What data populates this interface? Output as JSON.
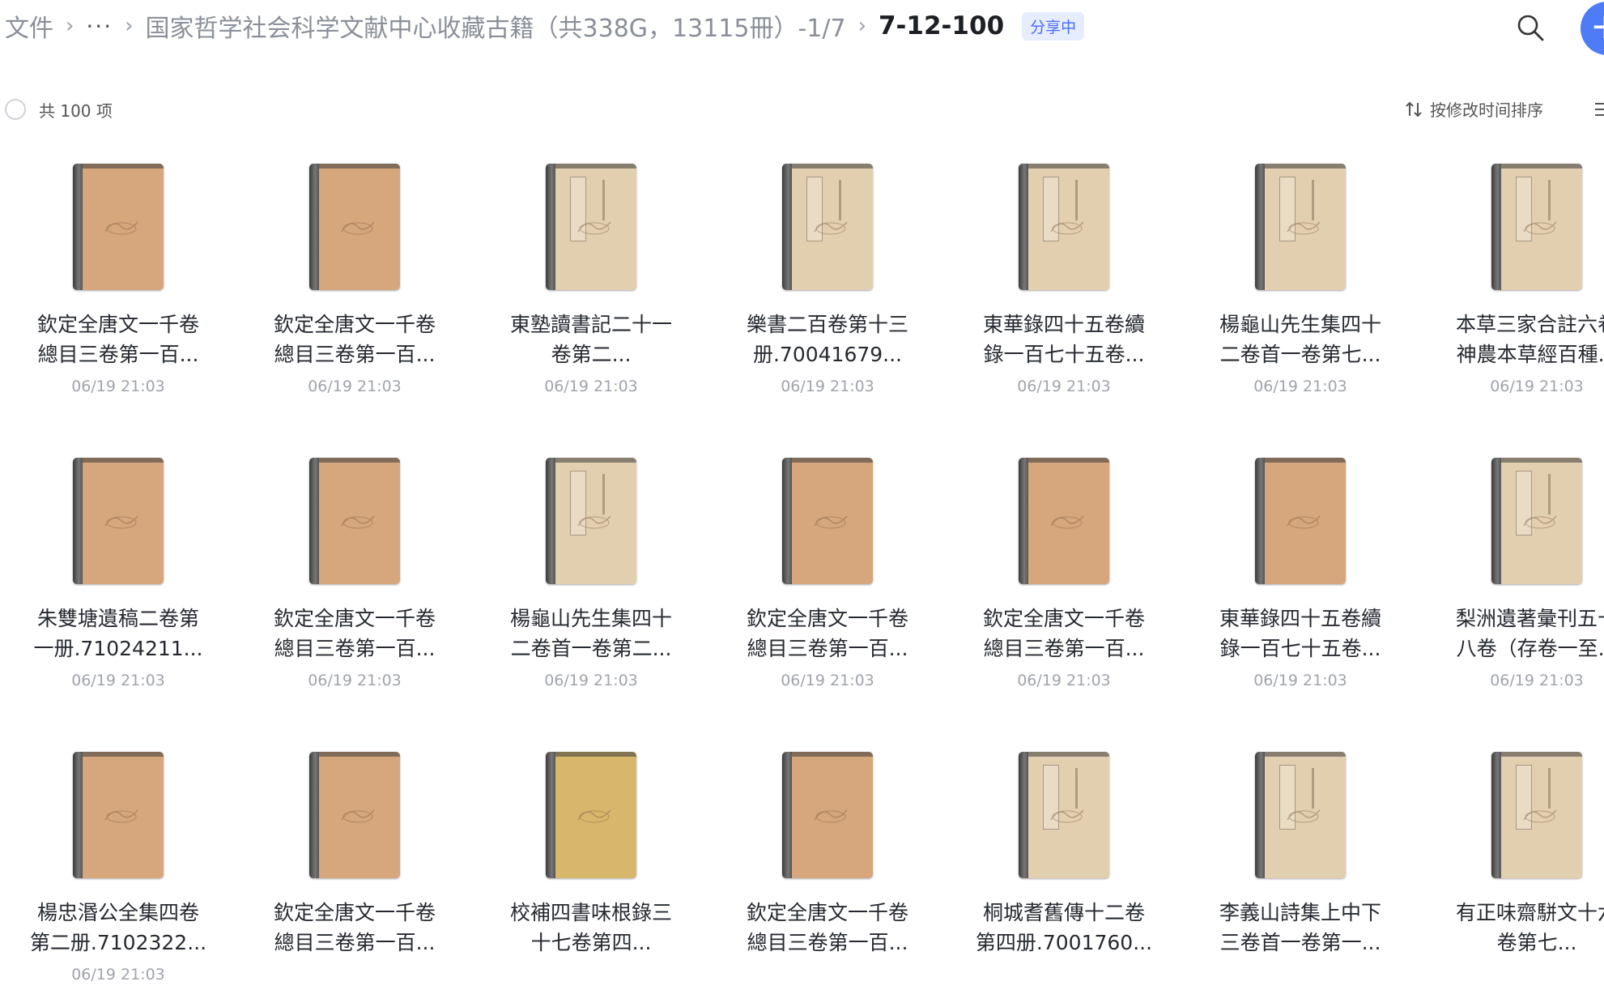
{
  "breadcrumb": {
    "root": "文件",
    "ellipsis": "···",
    "parent": "国家哲学社会科学文献中心收藏古籍（共338G，13115冊）-1/7",
    "current": "7-12-100",
    "badge": "分享中"
  },
  "toolbar": {
    "total": "共 100 项",
    "sort_label": "按修改时间排序"
  },
  "icons": {
    "search": "search-icon",
    "add": "plus-icon",
    "sort": "sort-arrows-icon",
    "view": "list-view-icon",
    "checkbox": "circle-checkbox-icon"
  },
  "colors": {
    "accent": "#4e7cf6",
    "badge_text": "#4a6cf7",
    "badge_bg": "#e6edff",
    "cover_tan": "#d6a67c",
    "cover_beige": "#e2cfb0",
    "cover_yellow": "#d7b76c"
  },
  "files": [
    {
      "line1": "欽定全唐文一千卷",
      "line2": "總目三卷第一百...",
      "time": "06/19 21:03",
      "cover": "tan"
    },
    {
      "line1": "欽定全唐文一千卷",
      "line2": "總目三卷第一百...",
      "time": "06/19 21:03",
      "cover": "tan"
    },
    {
      "line1": "東塾讀書記二十一",
      "line2": "卷第二...",
      "time": "06/19 21:03",
      "cover": "beige"
    },
    {
      "line1": "樂書二百卷第十三",
      "line2": "册.70041679...",
      "time": "06/19 21:03",
      "cover": "beige"
    },
    {
      "line1": "東華錄四十五卷續",
      "line2": "錄一百七十五卷...",
      "time": "06/19 21:03",
      "cover": "beige"
    },
    {
      "line1": "楊龜山先生集四十",
      "line2": "二卷首一卷第七...",
      "time": "06/19 21:03",
      "cover": "beige"
    },
    {
      "line1": "本草三家合註六卷",
      "line2": "神農本草經百種...",
      "time": "06/19 21:03",
      "cover": "beige"
    },
    {
      "line1": "朱雙塘遺稿二卷第",
      "line2": "一册.71024211...",
      "time": "06/19 21:03",
      "cover": "tan"
    },
    {
      "line1": "欽定全唐文一千卷",
      "line2": "總目三卷第一百...",
      "time": "06/19 21:03",
      "cover": "tan"
    },
    {
      "line1": "楊龜山先生集四十",
      "line2": "二卷首一卷第二...",
      "time": "06/19 21:03",
      "cover": "beige"
    },
    {
      "line1": "欽定全唐文一千卷",
      "line2": "總目三卷第一百...",
      "time": "06/19 21:03",
      "cover": "tan"
    },
    {
      "line1": "欽定全唐文一千卷",
      "line2": "總目三卷第一百...",
      "time": "06/19 21:03",
      "cover": "tan"
    },
    {
      "line1": "東華錄四十五卷續",
      "line2": "錄一百七十五卷...",
      "time": "06/19 21:03",
      "cover": "tan"
    },
    {
      "line1": "梨洲遺著彙刊五十",
      "line2": "八卷（存卷一至...",
      "time": "06/19 21:03",
      "cover": "beige"
    },
    {
      "line1": "楊忠湣公全集四卷",
      "line2": "第二册.7102322...",
      "time": "06/19 21:03",
      "cover": "tan"
    },
    {
      "line1": "欽定全唐文一千卷",
      "line2": "總目三卷第一百...",
      "time": "",
      "cover": "tan"
    },
    {
      "line1": "校補四書味根錄三",
      "line2": "十七卷第四...",
      "time": "",
      "cover": "yellow"
    },
    {
      "line1": "欽定全唐文一千卷",
      "line2": "總目三卷第一百...",
      "time": "",
      "cover": "tan"
    },
    {
      "line1": "桐城耆舊傳十二卷",
      "line2": "第四册.7001760...",
      "time": "",
      "cover": "beige"
    },
    {
      "line1": "李義山詩集上中下",
      "line2": "三卷首一卷第一...",
      "time": "",
      "cover": "beige"
    },
    {
      "line1": "有正味齋駢文十六",
      "line2": "卷第七...",
      "time": "",
      "cover": "beige"
    }
  ]
}
